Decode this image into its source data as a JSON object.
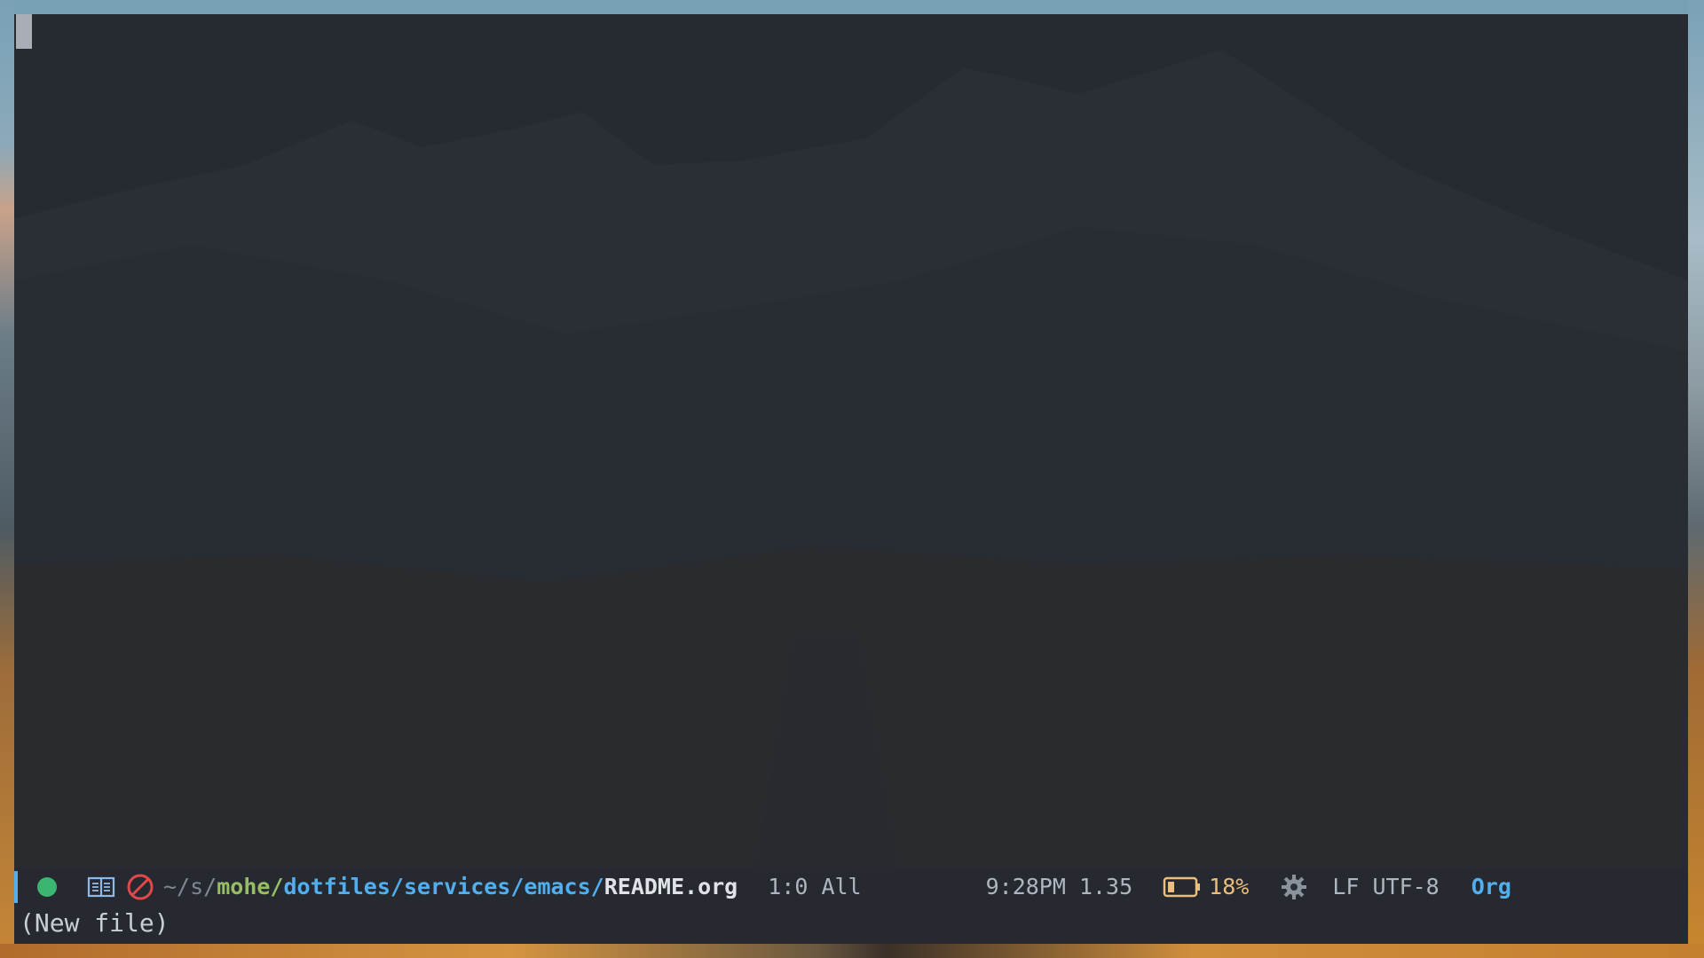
{
  "editor": {
    "buffer_text": "",
    "cursor": "block-cursor"
  },
  "modeline": {
    "status_dot_color": "#3bb56f",
    "icons": [
      "read-mode-book-icon",
      "no-entry-icon",
      "gear-icon",
      "battery-icon"
    ],
    "path": {
      "prefix": "~/s/",
      "project": "mohe/",
      "dirs": "dotfiles/services/emacs/",
      "file": "README.org"
    },
    "position": "1:0 All",
    "time_load": "9:28PM 1.35",
    "battery": "18%",
    "eol_encoding": "LF UTF-8",
    "major_mode": "Org"
  },
  "echo_area": {
    "message": "(New file)"
  },
  "colors": {
    "accent": "#51afef",
    "project": "#98be65",
    "battery": "#ecbe7b",
    "background": "#262a31"
  }
}
